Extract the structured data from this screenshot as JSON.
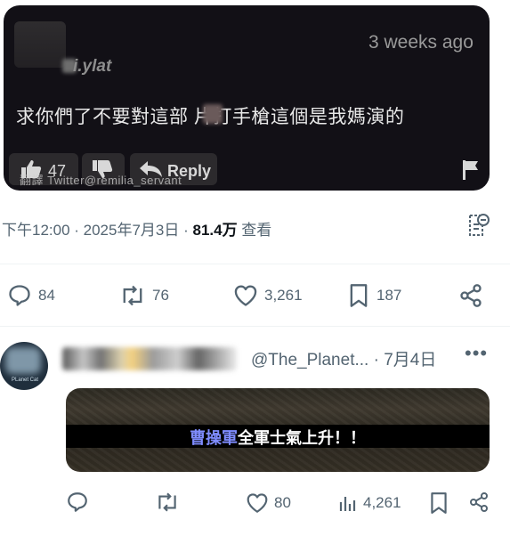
{
  "comment_card": {
    "username": "i.ylat",
    "timestamp": "3 weeks ago",
    "comment_text": "求你們了不要對這部  片打手槍這個是我媽演的",
    "like_count": "47",
    "reply_label": "Reply",
    "watermark": "翻譯 Twitter@remilia_servant"
  },
  "post_meta": {
    "time": "下午12:00 · 2025年7月3日 · ",
    "views": "81.4万",
    "views_label": " 查看"
  },
  "post_actions": {
    "replies": "84",
    "reposts": "76",
    "likes": "3,261",
    "bookmarks": "187"
  },
  "reply_tweet": {
    "avatar_text": "PLanet Cat",
    "handle": "@The_Planet...",
    "date": " · 7月4日",
    "more_label": "•••",
    "subtitle_highlight": "曹操軍",
    "subtitle_rest": "全軍士氣上升！！",
    "likes": "80",
    "views": "4,261"
  },
  "colors": {
    "text_primary": "#0f1419",
    "text_secondary": "#536471",
    "card_dark": "#121016",
    "subtitle_highlight": "#7f8cff"
  }
}
